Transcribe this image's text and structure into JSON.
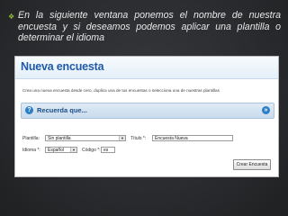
{
  "slide": {
    "bullet": "❖",
    "intro_text": "En la siguiente ventana ponemos el nombre de nuestra encuesta  y si deseamos podemos aplicar una plantilla o determinar el idioma"
  },
  "screenshot": {
    "title": "Nueva encuesta",
    "description": "Crea una nueva encuesta desde cero, duplica una de tus encuestas o selecciona una de nuestras plantillas",
    "reminder": {
      "icon": "?",
      "label": "Recuerda que...",
      "toggle_icon": "»"
    },
    "form": {
      "template_label": "Plantilla:",
      "template_value": "Sin plantilla",
      "title_label": "Título *:",
      "title_value": "Encuesta Nueva",
      "language_label": "Idioma *:",
      "language_value": "Español",
      "code_label": "Código *:",
      "code_value": "es",
      "create_button": "Crear Encuesta"
    }
  }
}
